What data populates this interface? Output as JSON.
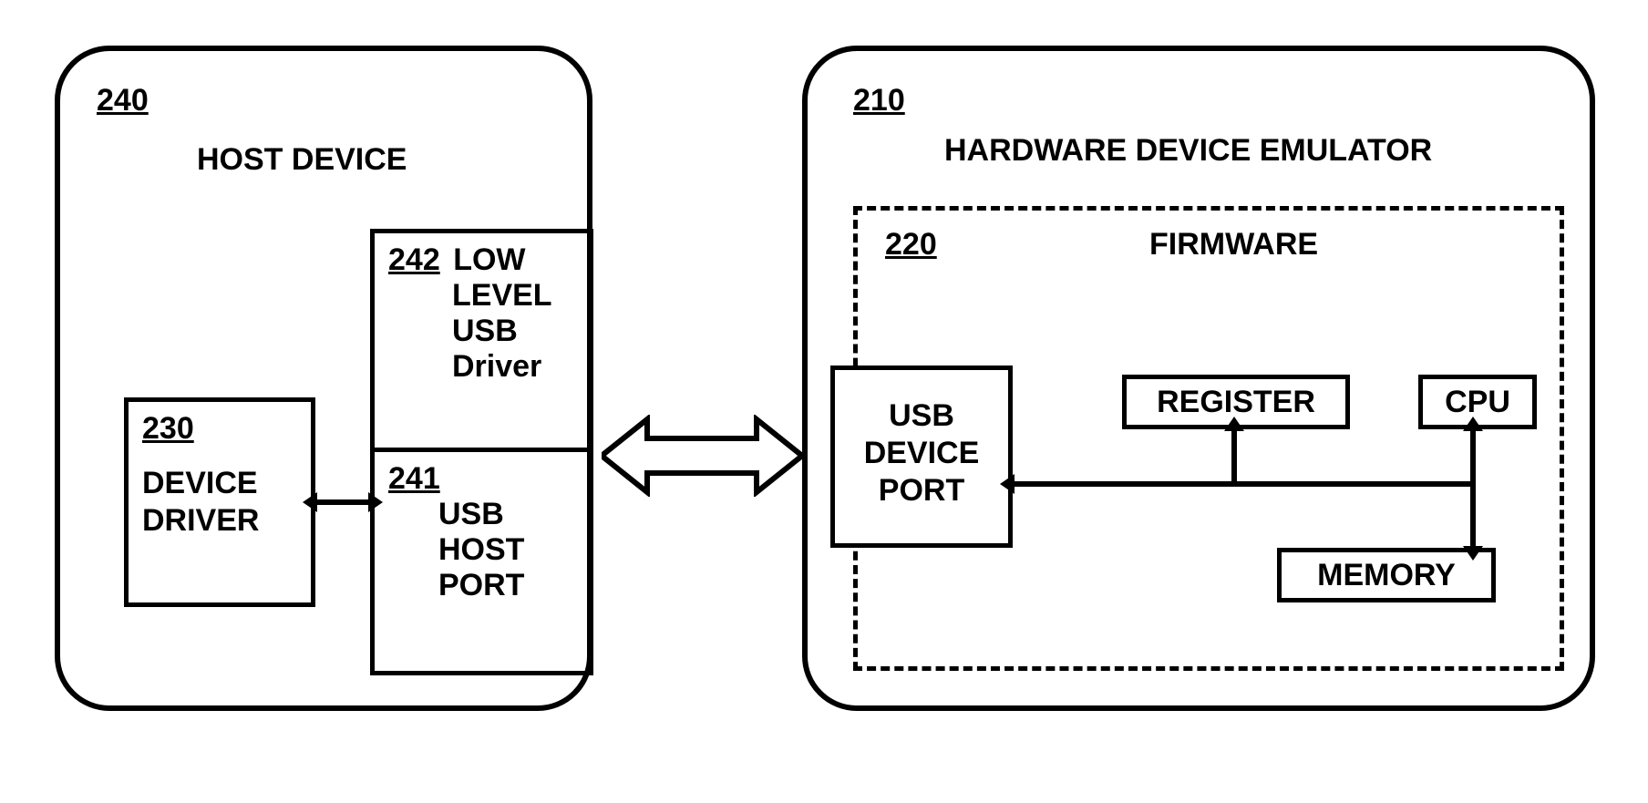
{
  "host": {
    "ref": "240",
    "title": "HOST DEVICE",
    "device_driver": {
      "ref": "230",
      "line1": "DEVICE",
      "line2": "DRIVER"
    },
    "low_level": {
      "ref": "242",
      "l1": "LOW",
      "l2": "LEVEL",
      "l3": "USB",
      "l4": "Driver"
    },
    "usb_host_port": {
      "ref": "241",
      "l1": "USB",
      "l2": "HOST",
      "l3": "PORT"
    }
  },
  "emulator": {
    "ref": "210",
    "title": "HARDWARE DEVICE EMULATOR",
    "firmware": {
      "ref": "220",
      "title": "FIRMWARE",
      "usb_device_port": {
        "l1": "USB",
        "l2": "DEVICE",
        "l3": "PORT"
      },
      "register": "REGISTER",
      "cpu": "CPU",
      "memory": "MEMORY"
    }
  }
}
